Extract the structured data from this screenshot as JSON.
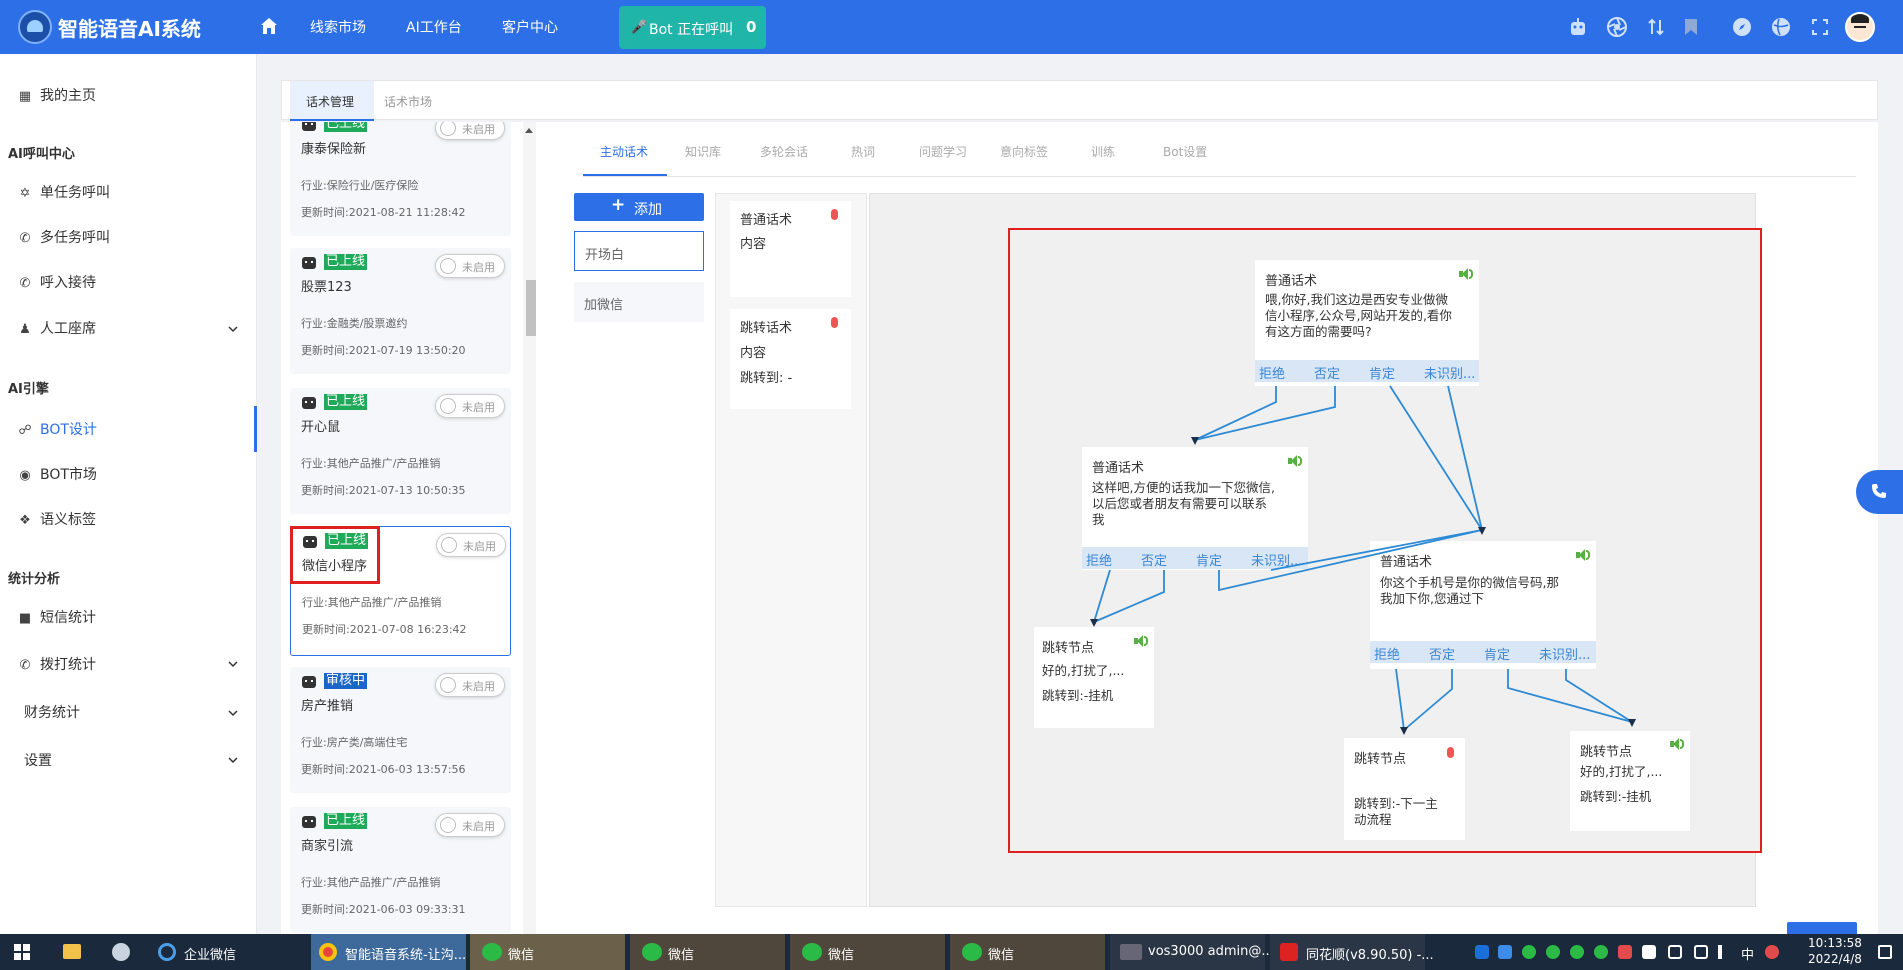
{
  "header": {
    "app_title": "智能语音AI系统",
    "nav": [
      "线索市场",
      "AI工作台",
      "客户中心"
    ],
    "bot_call_label": "Bot 正在呼叫",
    "bot_call_count": "0",
    "brand_color": "#2c6fe6"
  },
  "sidebar": {
    "home": "我的主页",
    "section_call": "AI呼叫中心",
    "single_task": "单任务呼叫",
    "multi_task": "多任务呼叫",
    "inbound": "呼入接待",
    "agent": "人工座席",
    "section_engine": "AI引擎",
    "bot_design": "BOT设计",
    "bot_market": "BOT市场",
    "semantic_tag": "语义标签",
    "section_stats": "统计分析",
    "sms_stats": "短信统计",
    "dial_stats": "拨打统计",
    "finance_stats": "财务统计",
    "settings": "设置"
  },
  "top_tabs": [
    "话术管理",
    "话术市场"
  ],
  "bots": [
    {
      "status": "已上线",
      "name": "康泰保险新",
      "toggle": "未启用",
      "industry": "行业:保险行业/医疗保险",
      "updated": "更新时间:2021-08-21 11:28:42"
    },
    {
      "status": "已上线",
      "name": "股票123",
      "toggle": "未启用",
      "industry": "行业:金融类/股票邀约",
      "updated": "更新时间:2021-07-19 13:50:20"
    },
    {
      "status": "已上线",
      "name": "开心鼠",
      "toggle": "未启用",
      "industry": "行业:其他产品推广/产品推销",
      "updated": "更新时间:2021-07-13 10:50:35"
    },
    {
      "status": "已上线",
      "name": "微信小程序",
      "toggle": "未启用",
      "industry": "行业:其他产品推广/产品推销",
      "updated": "更新时间:2021-07-08 16:23:42"
    },
    {
      "status": "审核中",
      "name": "房产推销",
      "toggle": "未启用",
      "industry": "行业:房产类/高端住宅",
      "updated": "更新时间:2021-06-03 13:57:56"
    },
    {
      "status": "已上线",
      "name": "商家引流",
      "toggle": "未启用",
      "industry": "行业:其他产品推广/产品推销",
      "updated": "更新时间:2021-06-03 09:33:31"
    }
  ],
  "bot_tabs": [
    "主动话术",
    "知识库",
    "多轮会话",
    "热词",
    "问题学习",
    "意向标签",
    "训练",
    "Bot设置"
  ],
  "flow": {
    "add_label": "添加",
    "items": [
      "开场白",
      "加微信"
    ]
  },
  "palette": {
    "normal_title": "普通话术",
    "normal_content": "内容",
    "jump_title": "跳转话术",
    "jump_content": "内容",
    "jump_to": "跳转到: -"
  },
  "canvas": {
    "branches": [
      "拒绝",
      "否定",
      "肯定",
      "未识别..."
    ],
    "node_a": {
      "title": "普通话术",
      "text": [
        "喂,你好,我们这边是西安专业做微",
        "信小程序,公众号,网站开发的,看你",
        "有这方面的需要吗?"
      ]
    },
    "node_b": {
      "title": "普通话术",
      "text": [
        "这样吧,方便的话我加一下您微信,",
        "以后您或者朋友有需要可以联系",
        "我"
      ]
    },
    "node_c": {
      "title": "普通话术",
      "text": [
        "你这个手机号是你的微信号码,那",
        "我加下你,您通过下"
      ]
    },
    "jump_1": {
      "title": "跳转节点",
      "text": "好的,打扰了,...",
      "jump": "跳转到:-挂机"
    },
    "jump_2": {
      "title": "跳转节点",
      "jump": [
        "跳转到:-下一主",
        "动流程"
      ]
    },
    "jump_3": {
      "title": "跳转节点",
      "text": "好的,打扰了,...",
      "jump": "跳转到:-挂机"
    }
  },
  "taskbar": {
    "items": [
      "企业微信",
      "智能语音系统-让沟...",
      "微信",
      "微信",
      "微信",
      "微信",
      "vos3000 admin@...",
      "同花顺(v8.90.50) -..."
    ],
    "ime": "中",
    "time": "10:13:58",
    "date": "2022/4/8"
  }
}
